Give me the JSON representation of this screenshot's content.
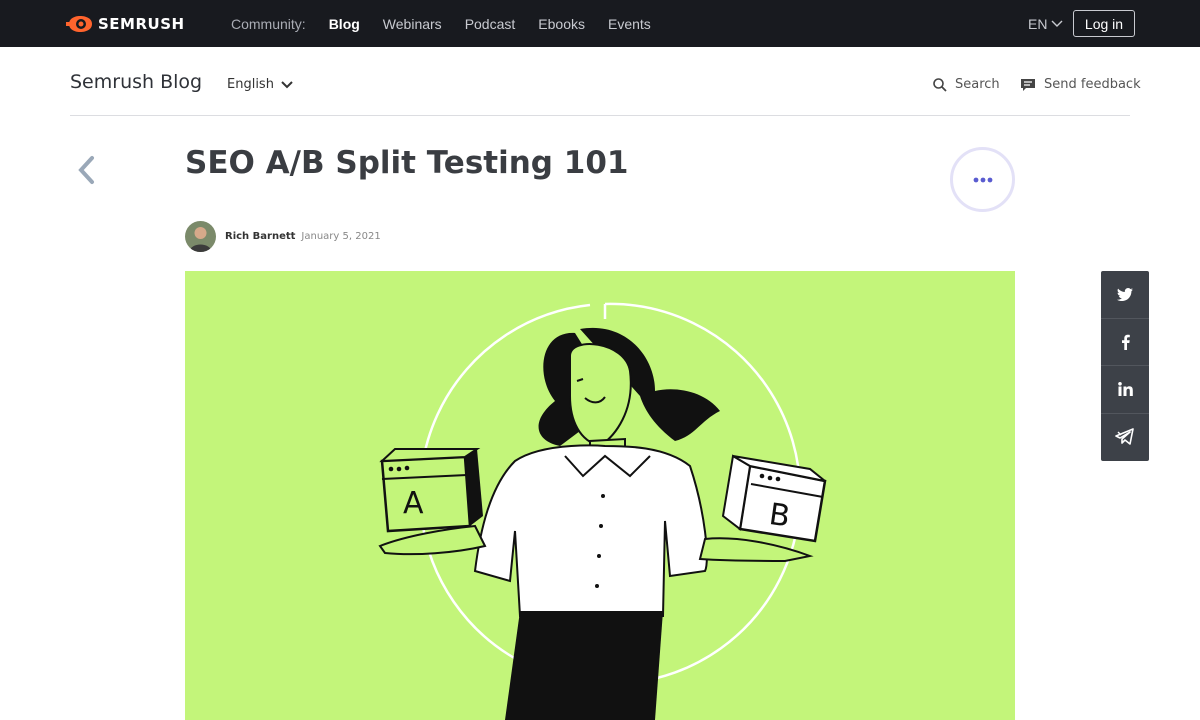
{
  "topbar": {
    "logo_text": "SEMRUSH",
    "nav_label": "Community:",
    "nav_items": [
      "Blog",
      "Webinars",
      "Podcast",
      "Ebooks",
      "Events"
    ],
    "active_item": "Blog",
    "language": "EN",
    "login_label": "Log in"
  },
  "blog_header": {
    "title": "Semrush Blog",
    "language": "English",
    "search_label": "Search",
    "feedback_label": "Send feedback"
  },
  "article": {
    "title": "SEO A/B Split Testing 101",
    "author": "Rich Barnett",
    "date": "January 5, 2021",
    "hero_box_a": "A",
    "hero_box_b": "B"
  },
  "share": {
    "icons": [
      "twitter-icon",
      "facebook-icon",
      "linkedin-icon",
      "telegram-icon"
    ]
  },
  "colors": {
    "topbar_bg": "#181a1f",
    "brand_orange": "#ff642d",
    "hero_bg": "#c3f57a",
    "share_bg": "#3d4148",
    "more_dots": "#5a5cd0"
  }
}
